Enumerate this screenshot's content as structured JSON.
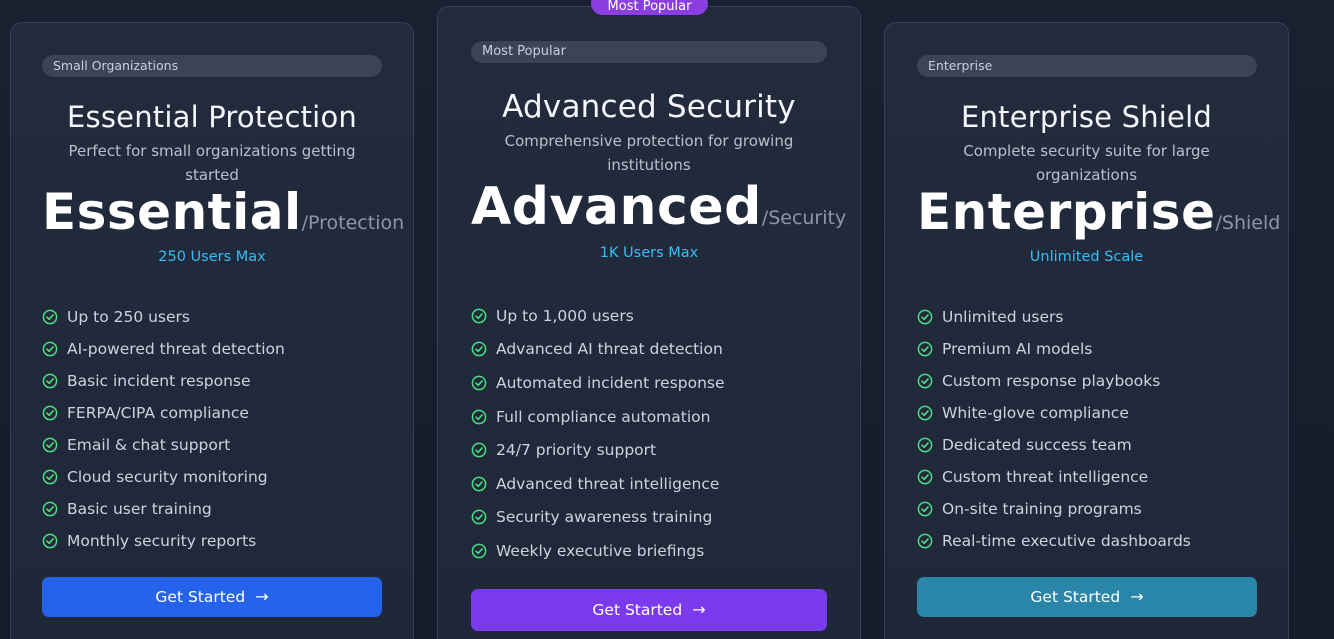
{
  "top_badge": "Most Popular",
  "plans": [
    {
      "tag": "Small Organizations",
      "title": "Essential Protection",
      "subtitle": "Perfect for small organizations getting started",
      "price_main": "Essential",
      "price_suffix": "/Protection",
      "limit": "250 Users Max",
      "features": [
        "Up to 250 users",
        "AI-powered threat detection",
        "Basic incident response",
        "FERPA/CIPA compliance",
        "Email & chat support",
        "Cloud security monitoring",
        "Basic user training",
        "Monthly security reports"
      ],
      "cta": "Get Started",
      "accent": "#2563eb"
    },
    {
      "tag": "Most Popular",
      "title": "Advanced Security",
      "subtitle": "Comprehensive protection for growing institutions",
      "price_main": "Advanced",
      "price_suffix": "/Security",
      "limit": "1K Users Max",
      "features": [
        "Up to 1,000 users",
        "Advanced AI threat detection",
        "Automated incident response",
        "Full compliance automation",
        "24/7 priority support",
        "Advanced threat intelligence",
        "Security awareness training",
        "Weekly executive briefings"
      ],
      "cta": "Get Started",
      "accent": "#7c3aed"
    },
    {
      "tag": "Enterprise",
      "title": "Enterprise Shield",
      "subtitle": "Complete security suite for large organizations",
      "price_main": "Enterprise",
      "price_suffix": "/Shield",
      "limit": "Unlimited Scale",
      "features": [
        "Unlimited users",
        "Premium AI models",
        "Custom response playbooks",
        "White-glove compliance",
        "Dedicated success team",
        "Custom threat intelligence",
        "On-site training programs",
        "Real-time executive dashboards"
      ],
      "cta": "Get Started",
      "accent": "#2a86a8"
    }
  ],
  "colors": {
    "check": "#4ade80",
    "limit": "#38bdf8",
    "badge": "#8b3fe0"
  },
  "icons": {
    "feature": "check-circle-icon",
    "cta": "arrow-right-icon"
  }
}
